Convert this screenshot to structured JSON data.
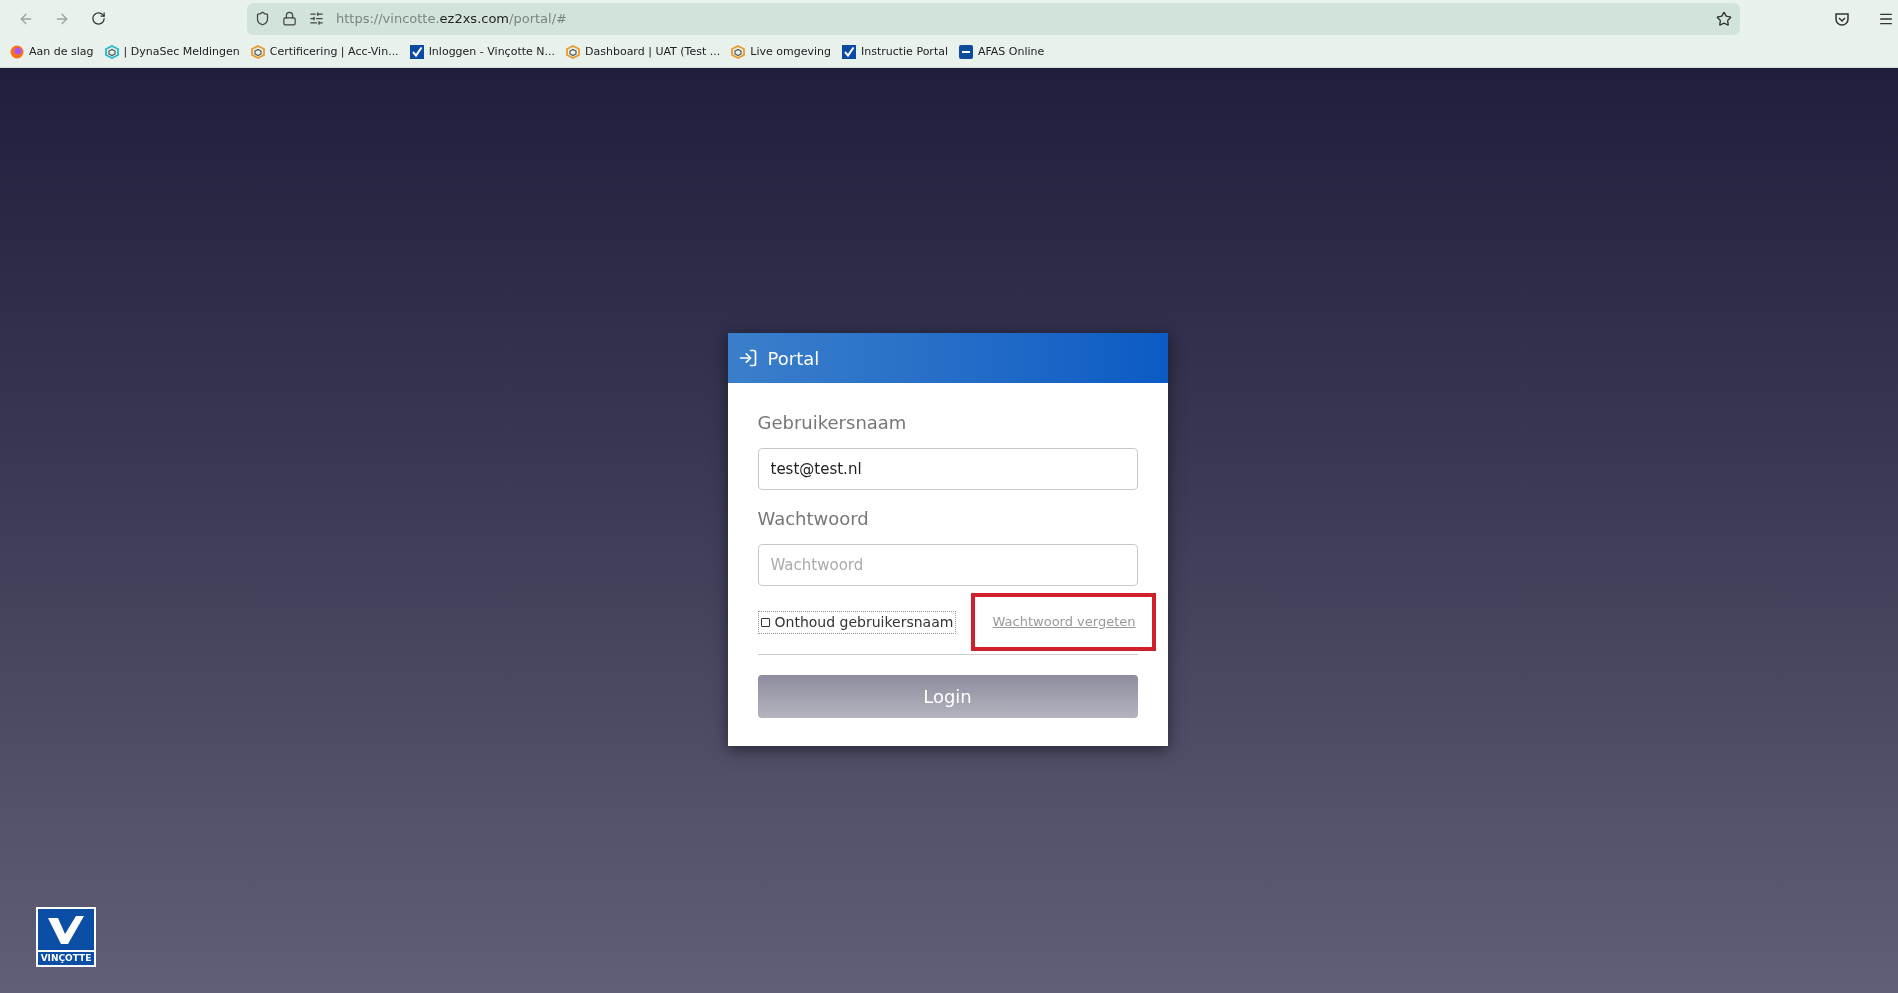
{
  "browser": {
    "url": {
      "prefix": "https://vincotte.",
      "domain": "ez2xs.com",
      "suffix": "/portal/#"
    }
  },
  "bookmarks": [
    {
      "label": "Aan de slag",
      "kind": "globe"
    },
    {
      "label": "| DynaSec Meldingen",
      "kind": "cube-teal"
    },
    {
      "label": "Certificering | Acc-Vin...",
      "kind": "cube-orange"
    },
    {
      "label": "Inloggen - Vinçotte N...",
      "kind": "check"
    },
    {
      "label": "Dashboard | UAT (Test ...",
      "kind": "cube-orange"
    },
    {
      "label": "Live omgeving",
      "kind": "cube-orange"
    },
    {
      "label": "Instructie Portal",
      "kind": "check"
    },
    {
      "label": "AFAS Online",
      "kind": "afas"
    }
  ],
  "login": {
    "title": "Portal",
    "username": {
      "label": "Gebruikersnaam",
      "value": "test@test.nl"
    },
    "password": {
      "label": "Wachtwoord",
      "placeholder": "Wachtwoord"
    },
    "remember": {
      "label": "Onthoud gebruikersnaam",
      "checked": false
    },
    "forgot": {
      "label": "Wachtwoord vergeten",
      "highlighted": true
    },
    "button": "Login"
  },
  "logo": {
    "text": "VINÇOTTE"
  }
}
